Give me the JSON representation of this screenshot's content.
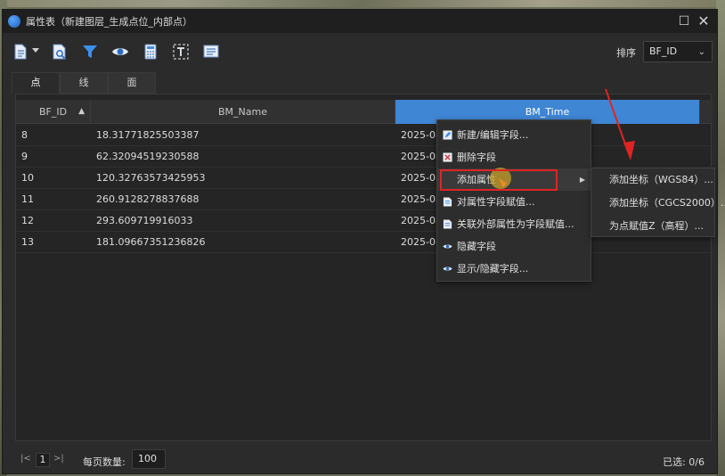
{
  "window": {
    "title": "属性表（新建图层_生成点位_内部点）",
    "maximize_glyph": "☐",
    "close_glyph": "✕"
  },
  "toolbar": {
    "icons": [
      "export-icon",
      "search-doc-icon",
      "filter-icon",
      "eye-icon",
      "calculator-icon",
      "text-field-icon",
      "list-icon"
    ],
    "sort_label": "排序",
    "sort_value": "BF_ID"
  },
  "tabs": [
    {
      "label": "点",
      "active": true
    },
    {
      "label": "线",
      "active": false
    },
    {
      "label": "面",
      "active": false
    }
  ],
  "table": {
    "columns": [
      "BF_ID",
      "BM_Name",
      "BM_Time"
    ],
    "sort_indicator": "▲",
    "rows": [
      [
        "8",
        "18.31771825503387",
        "2025-08-"
      ],
      [
        "9",
        "62.32094519230588",
        "2025-08-"
      ],
      [
        "10",
        "120.32763573425953",
        "2025-08-"
      ],
      [
        "11",
        "260.9128278837688",
        "2025-08-"
      ],
      [
        "12",
        "293.609719916033",
        "2025-08-"
      ],
      [
        "13",
        "181.09667351236826",
        "2025-08-"
      ]
    ]
  },
  "context_menu": {
    "items": [
      {
        "label": "新建/编辑字段...",
        "icon": "edit-icon"
      },
      {
        "label": "删除字段",
        "icon": "delete-icon"
      },
      {
        "label": "添加属性",
        "icon": "",
        "has_submenu": true
      },
      {
        "label": "对属性字段赋值...",
        "icon": "doc-icon"
      },
      {
        "label": "关联外部属性为字段赋值...",
        "icon": "doc-icon"
      },
      {
        "label": "隐藏字段",
        "icon": "eye-icon"
      },
      {
        "label": "显示/隐藏字段...",
        "icon": "eye-icon"
      }
    ],
    "submenu_arrow": "▶",
    "submenu": [
      "添加坐标（WGS84）...",
      "添加坐标（CGCS2000）...",
      "为点赋值Z（高程）..."
    ]
  },
  "footer": {
    "first_glyph": "|<",
    "page": "1",
    "last_glyph": ">|",
    "per_page_label": "每页数量:",
    "per_page_value": "100",
    "selected": "已选: 0/6"
  },
  "colors": {
    "accent": "#3f86d4",
    "highlight_box": "#e02424",
    "window_bg": "#2b2b2b"
  }
}
